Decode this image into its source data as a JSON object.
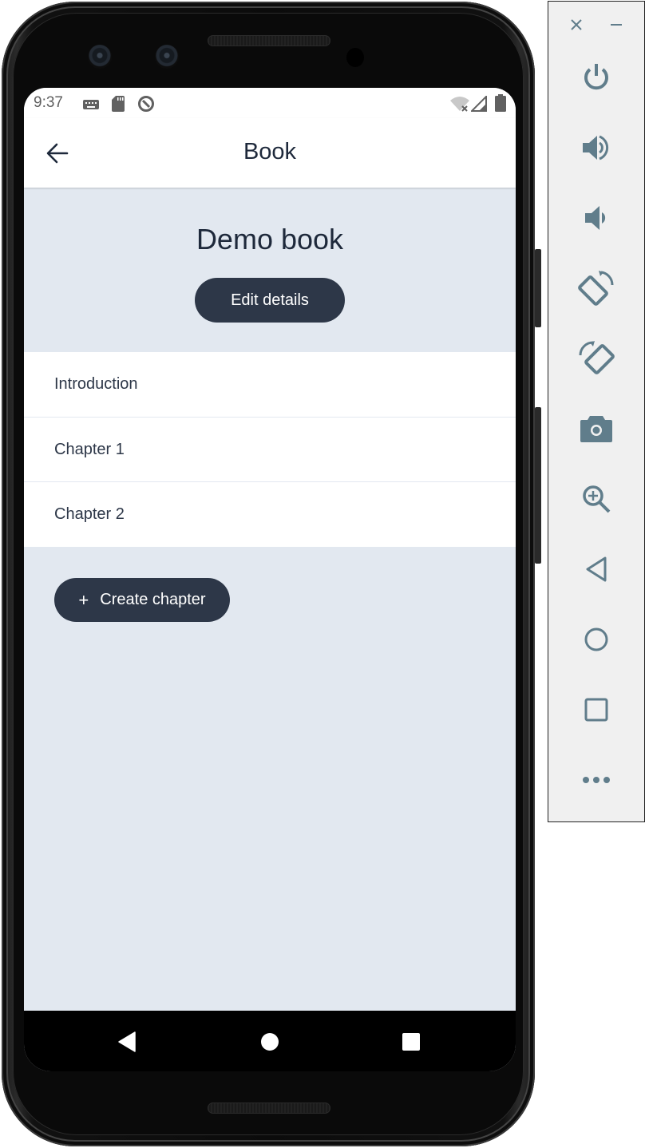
{
  "status_bar": {
    "time": "9:37",
    "left_icons": [
      "keyboard-icon",
      "sd-card-icon",
      "data-saver-icon"
    ],
    "right_icons": [
      "wifi-off-icon",
      "cellular-signal-icon",
      "battery-icon"
    ]
  },
  "app_bar": {
    "title": "Book",
    "back_icon": "arrow-left-icon"
  },
  "book": {
    "title": "Demo book",
    "edit_button_label": "Edit details"
  },
  "chapters": [
    {
      "label": "Introduction"
    },
    {
      "label": "Chapter 1"
    },
    {
      "label": "Chapter 2"
    }
  ],
  "create_chapter": {
    "icon": "+",
    "label": "Create chapter"
  },
  "nav_bar": {
    "buttons": [
      "back-icon",
      "home-icon",
      "recents-icon"
    ]
  },
  "emulator_panel": {
    "window_controls": [
      "close-icon",
      "minimize-icon"
    ],
    "buttons": [
      "power-icon",
      "volume-up-icon",
      "volume-down-icon",
      "rotate-left-icon",
      "rotate-right-icon",
      "camera-icon",
      "zoom-icon",
      "back-icon",
      "home-icon",
      "overview-icon",
      "more-icon"
    ]
  },
  "colors": {
    "screen_background": "#e2e8f0",
    "button_background": "#2d3748",
    "text_primary": "#1e293b",
    "emulator_icon": "#607d8b"
  }
}
